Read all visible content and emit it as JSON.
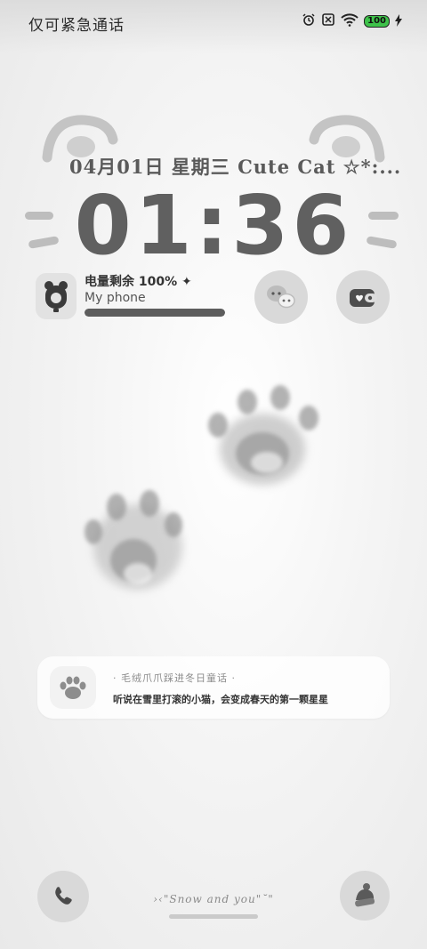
{
  "status_bar": {
    "carrier_text": "仅可紧急通话",
    "battery_level": "100",
    "icons": [
      "alarm-icon",
      "sim-icon",
      "wifi-icon",
      "battery-icon",
      "charging-icon"
    ]
  },
  "lock_screen": {
    "date_text": "04月01日 星期三 Cute Cat ☆*:...",
    "time": "01:36"
  },
  "battery_widget": {
    "title": "电量剩余 100% ✦",
    "device": "My phone",
    "level_fraction": 1.0
  },
  "shortcuts": {
    "left_icon": "chat-bubbles-icon",
    "right_icon": "wallet-icon"
  },
  "notification": {
    "title": "· 毛绒爪爪踩进冬日童话 ·",
    "body": "听说在雪里打滚的小猫，会变成春天的第一颗星星"
  },
  "bottom": {
    "caption": "›‹\"Snow and you\"˘\"",
    "left_shortcut": "phone-icon",
    "right_shortcut": "beanie-hat-icon"
  },
  "colors": {
    "background": "#f1f1f1",
    "clock": "#606060",
    "battery_accent": "#3ec24a"
  }
}
